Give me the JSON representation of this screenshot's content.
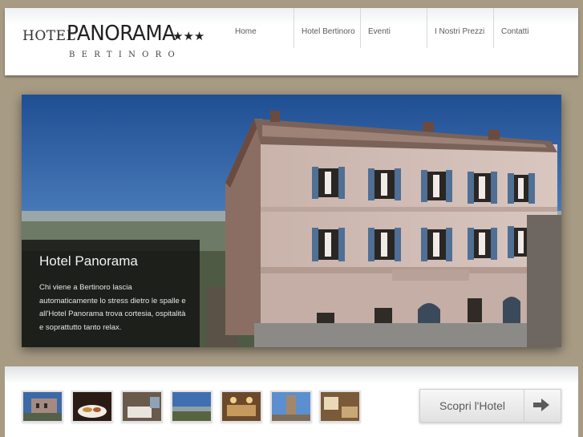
{
  "header": {
    "logo": {
      "hotel": "HOTEL",
      "name": "PANORAMA",
      "stars": "★★★",
      "town": "BERTINORO"
    },
    "nav": [
      {
        "label": "Home"
      },
      {
        "label": "Hotel Bertinoro"
      },
      {
        "label": "Eventi"
      },
      {
        "label": "I Nostri Prezzi"
      },
      {
        "label": "Contatti"
      }
    ]
  },
  "hero": {
    "caption_title": "Hotel Panorama",
    "caption_text": "Chi viene a Bertinoro lascia automaticamente lo stress dietro le spalle e all'Hotel Panorama trova cortesia, ospitalità e soprattutto tanto relax."
  },
  "footer": {
    "thumbnails": [
      {
        "name": "thumb-hotel-facade"
      },
      {
        "name": "thumb-breakfast"
      },
      {
        "name": "thumb-bedroom"
      },
      {
        "name": "thumb-panorama-view"
      },
      {
        "name": "thumb-dining-room"
      },
      {
        "name": "thumb-tower"
      },
      {
        "name": "thumb-room-interior"
      }
    ],
    "cta_label": "Scopri l'Hotel",
    "cta_icon": "arrow-right-icon"
  }
}
